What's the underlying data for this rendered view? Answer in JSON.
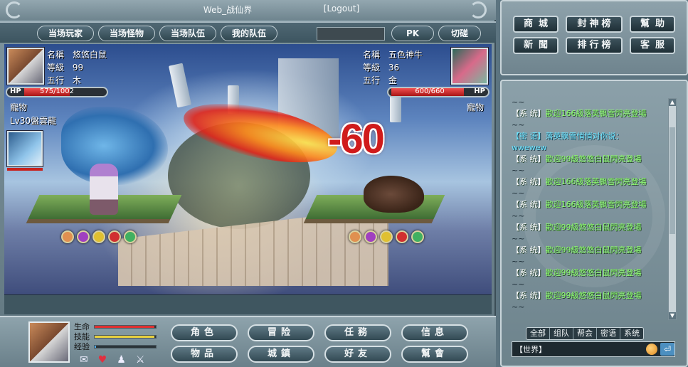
{
  "window": {
    "title": "Web_战仙界",
    "logout_label": "[Logout]"
  },
  "tabs": [
    {
      "label": "当场玩家"
    },
    {
      "label": "当场怪物"
    },
    {
      "label": "当场队伍"
    },
    {
      "label": "我的队伍"
    },
    {
      "label": "PK"
    },
    {
      "label": "切磋"
    }
  ],
  "player": {
    "name_label": "名稱",
    "name": "悠悠白鼠",
    "level_label": "等級",
    "level": "99",
    "element_label": "五行",
    "element": "木",
    "hp_label": "HP",
    "hp_text": "575/1002",
    "hp_current": 575,
    "hp_max": 1002,
    "pet_label": "寵物",
    "pet_name": "Lv30盤雲龍"
  },
  "enemy": {
    "name_label": "名稱",
    "name": "五色神牛",
    "level_label": "等級",
    "level": "36",
    "element_label": "五行",
    "element": "金",
    "hp_label": "HP",
    "hp_text": "600/660",
    "hp_current": 600,
    "hp_max": 660,
    "pet_label": "寵物"
  },
  "battle": {
    "damage_text": "-60"
  },
  "status": {
    "life_label": "生命",
    "skill_label": "技能",
    "exp_label": "经验",
    "life_fraction": 0.98,
    "skill_fraction": 0.98,
    "exp_fraction": 0.02,
    "colors": {
      "life": "#e03030",
      "skill": "#e8d040",
      "exp": "#4aa8e8"
    }
  },
  "commands": [
    {
      "label": "角色"
    },
    {
      "label": "冒险"
    },
    {
      "label": "任務"
    },
    {
      "label": "信息"
    },
    {
      "label": "物品"
    },
    {
      "label": "城鎮"
    },
    {
      "label": "好友"
    },
    {
      "label": "幫會"
    }
  ],
  "shop_buttons": [
    {
      "label": "商城"
    },
    {
      "label": "封神榜"
    },
    {
      "label": "幫助"
    },
    {
      "label": "新聞"
    },
    {
      "label": "排行榜"
    },
    {
      "label": "客服"
    }
  ],
  "chat": {
    "lines": [
      {
        "type": "tilde",
        "tag": "",
        "text": "~~"
      },
      {
        "type": "sys",
        "tag": "【系 统】",
        "text": "歡迎166級落英飘雪閃亮登場"
      },
      {
        "type": "tilde",
        "tag": "",
        "text": "~~"
      },
      {
        "type": "priv",
        "tag": "【密 语】",
        "text": "落英飘雪悄悄对你说："
      },
      {
        "type": "priv",
        "tag": "",
        "text": "wwewew"
      },
      {
        "type": "sys",
        "tag": "【系 统】",
        "text": "歡迎99級悠悠白鼠閃亮登場"
      },
      {
        "type": "tilde",
        "tag": "",
        "text": "~~"
      },
      {
        "type": "sys",
        "tag": "【系 统】",
        "text": "歡迎166級落英飘雪閃亮登場"
      },
      {
        "type": "tilde",
        "tag": "",
        "text": "~~"
      },
      {
        "type": "sys",
        "tag": "【系 统】",
        "text": "歡迎166級落英飘雪閃亮登場"
      },
      {
        "type": "tilde",
        "tag": "",
        "text": "~~"
      },
      {
        "type": "sys",
        "tag": "【系 统】",
        "text": "歡迎99級悠悠白鼠閃亮登場"
      },
      {
        "type": "tilde",
        "tag": "",
        "text": "~~"
      },
      {
        "type": "sys",
        "tag": "【系 统】",
        "text": "歡迎99級悠悠白鼠閃亮登場"
      },
      {
        "type": "tilde",
        "tag": "",
        "text": "~~"
      },
      {
        "type": "sys",
        "tag": "【系 统】",
        "text": "歡迎99級悠悠白鼠閃亮登場"
      },
      {
        "type": "tilde",
        "tag": "",
        "text": "~~"
      },
      {
        "type": "sys",
        "tag": "【系 统】",
        "text": "歡迎99級悠悠白鼠閃亮登場"
      },
      {
        "type": "tilde",
        "tag": "",
        "text": "~~"
      }
    ],
    "tabs": [
      {
        "label": "全部"
      },
      {
        "label": "组队"
      },
      {
        "label": "帮会"
      },
      {
        "label": "密语"
      },
      {
        "label": "系统"
      }
    ],
    "channel": "【世界】",
    "input_value": ""
  }
}
